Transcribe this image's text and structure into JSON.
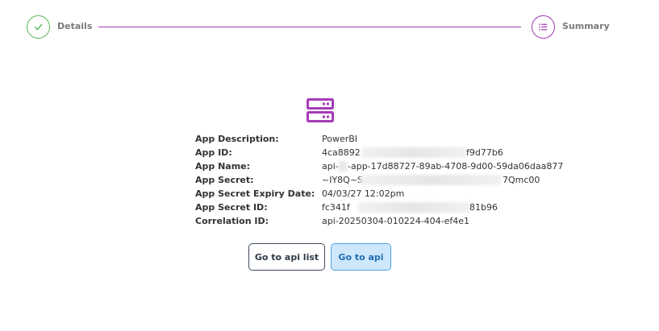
{
  "stepper": {
    "steps": [
      {
        "label": "Details",
        "state": "complete",
        "color": "#5cb85c",
        "icon": "check-icon"
      },
      {
        "label": "Summary",
        "state": "active",
        "color": "#a43bb8",
        "icon": "list-icon"
      }
    ]
  },
  "summary": {
    "icon": "server-icon",
    "icon_color": "#a43bb8",
    "rows": [
      {
        "label": "App Description:",
        "value": "PowerBI"
      },
      {
        "label": "App ID:",
        "value_start": "4ca8892",
        "value_end": "f9d77b6"
      },
      {
        "label": "App Name:",
        "value_start": "api-",
        "value_end": "-app-17d88727-89ab-4708-9d00-59da06daa877"
      },
      {
        "label": "App Secret:",
        "value_start": "~IY8Q~S",
        "value_end": "7Qmc00"
      },
      {
        "label": "App Secret Expiry Date:",
        "value": "04/03/27 12:02pm"
      },
      {
        "label": "App Secret ID:",
        "value_start": "fc341f",
        "value_end": "81b96"
      },
      {
        "label": "Correlation ID:",
        "value": "api-20250304-010224-404-ef4e1"
      }
    ]
  },
  "actions": {
    "go_to_api_list": "Go to api list",
    "go_to_api": "Go to api"
  }
}
